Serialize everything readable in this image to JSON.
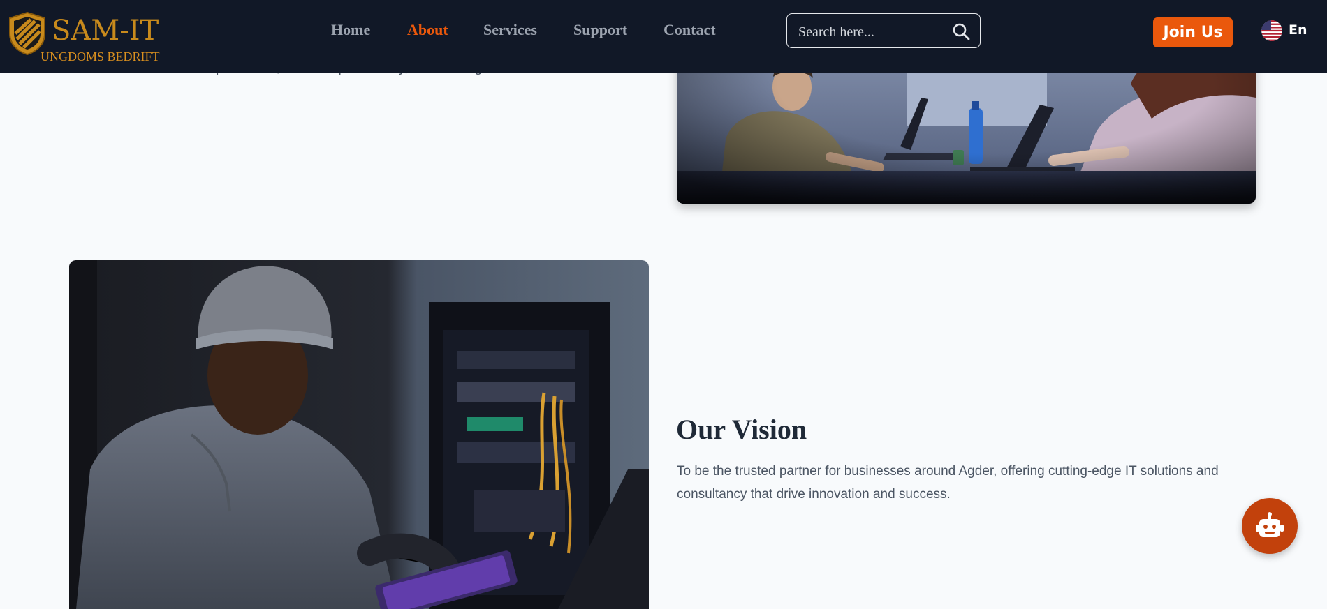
{
  "header": {
    "brand": "SAM-IT",
    "brand_sub": "UNGDOMS BEDRIFT",
    "nav": [
      {
        "label": "Home",
        "active": false
      },
      {
        "label": "About",
        "active": true
      },
      {
        "label": "Services",
        "active": false
      },
      {
        "label": "Support",
        "active": false
      },
      {
        "label": "Contact",
        "active": false
      }
    ],
    "search": {
      "placeholder": "Search here...",
      "icon": "search-icon"
    },
    "join_label": "Join Us",
    "language": {
      "label": "En",
      "icon": "us-flag-icon"
    }
  },
  "mission": {
    "text": "solutions that streamline processes, enhance productivity, and foster growth."
  },
  "vision": {
    "title": "Our Vision",
    "text": "To be the trusted partner for businesses around Agder, offering cutting-edge IT solutions and consultancy that drive innovation and success."
  },
  "chat": {
    "icon": "robot-icon"
  },
  "colors": {
    "navbar_bg": "#111827",
    "accent": "#ea580c",
    "brand_gold": "#c88a1c",
    "page_bg": "#f8fafc"
  }
}
